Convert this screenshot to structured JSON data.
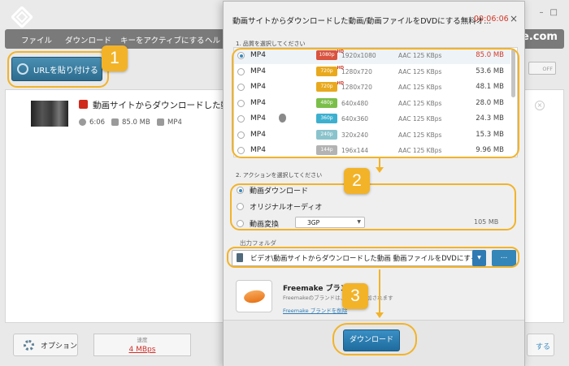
{
  "app": {
    "menu": [
      "ファイル",
      "ダウンロード",
      "キーをアクティブにする",
      "ヘル"
    ],
    "site_fragment": "e.com",
    "url_button": "URLを貼り付ける",
    "toggle_label": "OFF",
    "item": {
      "title": "動画サイトからダウンロードした動画 動画",
      "duration": "6:06",
      "size": "85.0 MB",
      "format": "MP4"
    },
    "options_button": "オプション",
    "speed_label": "速度",
    "speed_value": "4  MBps",
    "right_button_fragment": "する"
  },
  "dialog": {
    "title": "動画サイトからダウンロードした動画/動画ファイルをDVDにする無料オ...",
    "timer": "00:06:06",
    "close": "×",
    "section1": "1. 品質を選択してください",
    "qualities": [
      {
        "format": "MP4",
        "badge": "1080p",
        "hd": "HD",
        "badge_color": "#d9533f",
        "resolution": "1920x1080",
        "audio": "AAC 125  KBps",
        "size": "85.0 MB",
        "selected": true,
        "apple": false
      },
      {
        "format": "MP4",
        "badge": "720p",
        "hd": "HD",
        "badge_color": "#e8a91e",
        "resolution": "1280x720",
        "audio": "AAC 125  KBps",
        "size": "53.6 MB",
        "selected": false,
        "apple": false
      },
      {
        "format": "MP4",
        "badge": "720p",
        "hd": "HD",
        "badge_color": "#e8a91e",
        "resolution": "1280x720",
        "audio": "AAC 125  KBps",
        "size": "48.1 MB",
        "selected": false,
        "apple": false
      },
      {
        "format": "MP4",
        "badge": "480p",
        "hd": "",
        "badge_color": "#7bbf4a",
        "resolution": "640x480",
        "audio": "AAC 125  KBps",
        "size": "28.0 MB",
        "selected": false,
        "apple": false
      },
      {
        "format": "MP4",
        "badge": "360p",
        "hd": "",
        "badge_color": "#3db0cf",
        "resolution": "640x360",
        "audio": "AAC 125  KBps",
        "size": "24.3 MB",
        "selected": false,
        "apple": true
      },
      {
        "format": "MP4",
        "badge": "240p",
        "hd": "",
        "badge_color": "#8bc3cc",
        "resolution": "320x240",
        "audio": "AAC 125  KBps",
        "size": "15.3 MB",
        "selected": false,
        "apple": false
      },
      {
        "format": "MP4",
        "badge": "144p",
        "hd": "",
        "badge_color": "#b3b3b3",
        "resolution": "196x144",
        "audio": "AAC 125  KBps",
        "size": "9.96 MB",
        "selected": false,
        "apple": false
      }
    ],
    "section2": "2. アクションを選択してください",
    "actions": {
      "download": "動画ダウンロード",
      "audio": "オリジナルオーディオ",
      "convert": "動画変換",
      "convert_format": "3GP",
      "convert_size": "105 MB"
    },
    "output_label": "出力フォルダ",
    "output_path": "ビデオ\\動画サイトからダウンロードした動画 動画ファイルをDVDにする無料",
    "browse": "...",
    "brand_title": "Freemake ブランド",
    "brand_desc": "Freemakeのブランドは、動画に追加されます",
    "brand_link": "Freemake ブランドを削除",
    "download_button": "ダウンロード"
  },
  "annotations": [
    "1",
    "2",
    "3"
  ],
  "colors": {
    "accent_blue": "#2f7ab3",
    "highlight_orange": "#f2b329",
    "timer_red": "#d23a2a"
  }
}
